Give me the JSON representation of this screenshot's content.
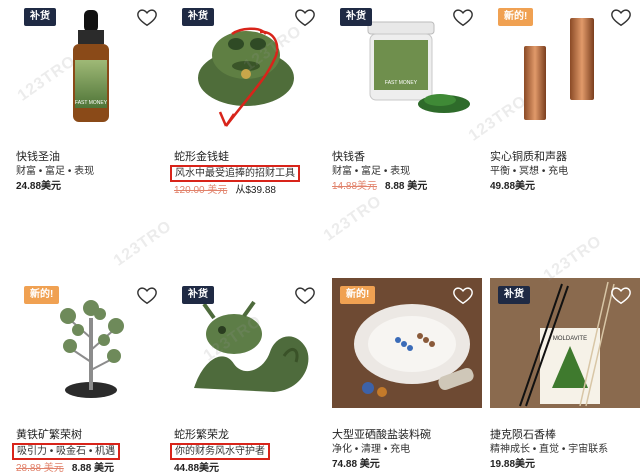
{
  "products": [
    {
      "badge": "补货",
      "badge_type": "restock",
      "name": "快钱圣油",
      "tags": "财富 • 富足 • 表现",
      "old_price": "",
      "price": "24.88美元",
      "tags_boxed": false
    },
    {
      "badge": "补货",
      "badge_type": "restock",
      "name": "蛇形金钱蛙",
      "tags": "风水中最受追捧的招财工具",
      "old_price": "120.00 美元",
      "price": "从$39.88",
      "tags_boxed": true
    },
    {
      "badge": "补货",
      "badge_type": "restock",
      "name": "快钱香",
      "tags": "财富 • 富足 • 表现",
      "old_price": "14.88美元",
      "price": "8.88 美元",
      "tags_boxed": false
    },
    {
      "badge": "新的!",
      "badge_type": "new",
      "name": "实心铜质和声器",
      "tags": "平衡 • 冥想 • 充电",
      "old_price": "",
      "price": "49.88美元",
      "tags_boxed": false
    },
    {
      "badge": "新的!",
      "badge_type": "new",
      "name": "黄铁矿繁荣树",
      "tags": "吸引力 • 吸金石 • 机遇",
      "old_price": "28.88 美元",
      "price": "8.88 美元",
      "tags_boxed": true
    },
    {
      "badge": "补货",
      "badge_type": "restock",
      "name": "蛇形繁荣龙",
      "tags": "你的财务风水守护者",
      "old_price": "",
      "price": "44.88美元",
      "tags_boxed": true
    },
    {
      "badge": "新的!",
      "badge_type": "new",
      "name": "大型亚硒酸盐装料碗",
      "tags": "净化 • 清理 • 充电",
      "old_price": "",
      "price": "74.88 美元",
      "tags_boxed": false
    },
    {
      "badge": "补货",
      "badge_type": "restock",
      "name": "捷克陨石香棒",
      "tags": "精神成长 • 直觉 • 宇宙联系",
      "old_price": "",
      "price": "19.88美元",
      "tags_boxed": false
    }
  ],
  "image_labels": {
    "oil_label": "FAST MONEY",
    "incense_label": "FAST MONEY",
    "incense_card_title": "MOLDAVITE"
  },
  "watermark": "123TRO",
  "colors": {
    "restock": "#1f2a44",
    "new": "#f0a152",
    "highlight": "#d8241a",
    "old_price": "#e1826b"
  }
}
